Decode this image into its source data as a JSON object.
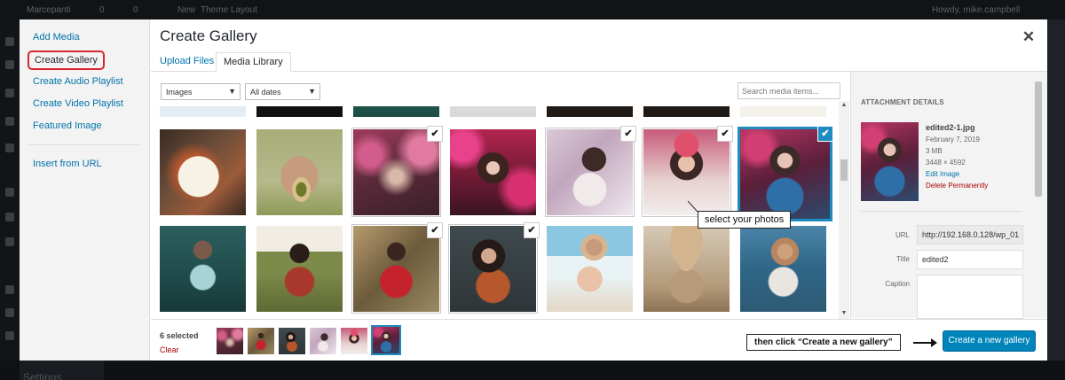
{
  "background": {
    "adminbar_items": [
      "Marcepanti",
      "0",
      "0",
      "New",
      "Theme Layout"
    ],
    "adminbar_right": "Howdy, mike.campbell",
    "bottom_item": "Settings"
  },
  "modal": {
    "menu": {
      "items": [
        {
          "label": "Add Media"
        },
        {
          "label": "Create Gallery"
        },
        {
          "label": "Create Audio Playlist"
        },
        {
          "label": "Create Video Playlist"
        },
        {
          "label": "Featured Image"
        }
      ],
      "insert_url": "Insert from URL"
    },
    "title": "Create Gallery",
    "close_icon": "close-icon",
    "tabs": [
      {
        "label": "Upload Files"
      },
      {
        "label": "Media Library"
      }
    ],
    "filters": {
      "type": "Images",
      "date": "All dates",
      "search_placeholder": "Search media items..."
    },
    "grid": {
      "top_row": [
        "p-top1",
        "p-top2",
        "p-top3",
        "p-top4",
        "p-top5",
        "p-top6",
        "p-top7"
      ],
      "row1": [
        {
          "photo": "p-salad",
          "selected": false
        },
        {
          "photo": "p-avocado",
          "selected": false
        },
        {
          "photo": "p-flowers",
          "selected": true
        },
        {
          "photo": "p-pink",
          "selected": false
        },
        {
          "photo": "p-white",
          "selected": true
        },
        {
          "photo": "p-crown",
          "selected": true
        },
        {
          "photo": "p-blueflower",
          "selected": true,
          "focused": true
        }
      ],
      "row2": [
        {
          "photo": "p-teal",
          "selected": false
        },
        {
          "photo": "p-field",
          "selected": false
        },
        {
          "photo": "p-redtop",
          "selected": true
        },
        {
          "photo": "p-rust",
          "selected": true
        },
        {
          "photo": "p-beach",
          "selected": false
        },
        {
          "photo": "p-hat",
          "selected": false
        },
        {
          "photo": "p-lake",
          "selected": false
        }
      ],
      "check_icon": "✔"
    },
    "tooltip": "select your photos",
    "details": {
      "heading": "ATTACHMENT DETAILS",
      "filename": "edited2-1.jpg",
      "date": "February 7, 2019",
      "size": "3 MB",
      "dimensions": "3448 × 4592",
      "edit_link": "Edit Image",
      "delete_link": "Delete Permanently",
      "fields": {
        "url_label": "URL",
        "url_value": "http://192.168.0.128/wp_01",
        "title_label": "Title",
        "title_value": "edited2",
        "caption_label": "Caption"
      }
    },
    "toolbar": {
      "selected_count": "6 selected",
      "clear": "Clear",
      "thumbs": [
        "p-flowers",
        "p-redtop",
        "p-rust",
        "p-white",
        "p-crown",
        "p-blueflower"
      ],
      "callout": "then click “Create a new gallery”",
      "create_button": "Create a new gallery"
    }
  },
  "colors": {
    "accent": "#0085ba",
    "link": "#0073aa",
    "delete": "#aa0000",
    "highlight": "#d9272e"
  }
}
